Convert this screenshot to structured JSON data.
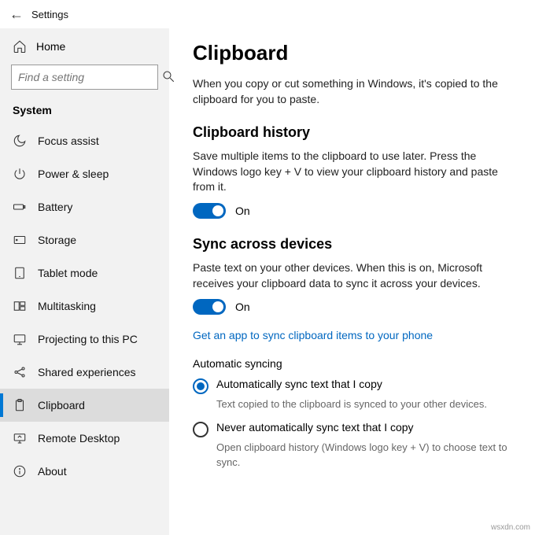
{
  "titlebar": {
    "title": "Settings"
  },
  "sidebar": {
    "home": "Home",
    "search_placeholder": "Find a setting",
    "category": "System",
    "items": [
      {
        "label": "Focus assist",
        "selected": false,
        "icon": "moon"
      },
      {
        "label": "Power & sleep",
        "selected": false,
        "icon": "power"
      },
      {
        "label": "Battery",
        "selected": false,
        "icon": "battery"
      },
      {
        "label": "Storage",
        "selected": false,
        "icon": "storage"
      },
      {
        "label": "Tablet mode",
        "selected": false,
        "icon": "tablet"
      },
      {
        "label": "Multitasking",
        "selected": false,
        "icon": "multitask"
      },
      {
        "label": "Projecting to this PC",
        "selected": false,
        "icon": "project"
      },
      {
        "label": "Shared experiences",
        "selected": false,
        "icon": "shared"
      },
      {
        "label": "Clipboard",
        "selected": true,
        "icon": "clipboard"
      },
      {
        "label": "Remote Desktop",
        "selected": false,
        "icon": "remote"
      },
      {
        "label": "About",
        "selected": false,
        "icon": "about"
      }
    ]
  },
  "main": {
    "title": "Clipboard",
    "intro": "When you copy or cut something in Windows, it's copied to the clipboard for you to paste.",
    "history": {
      "heading": "Clipboard history",
      "desc": "Save multiple items to the clipboard to use later. Press the Windows logo key + V to view your clipboard history and paste from it.",
      "toggle_state": "On"
    },
    "sync": {
      "heading": "Sync across devices",
      "desc": "Paste text on your other devices. When this is on, Microsoft receives your clipboard data to sync it across your devices.",
      "toggle_state": "On",
      "link": "Get an app to sync clipboard items to your phone",
      "auto_heading": "Automatic syncing",
      "radios": [
        {
          "label": "Automatically sync text that I copy",
          "desc": "Text copied to the clipboard is synced to your other devices.",
          "checked": true
        },
        {
          "label": "Never automatically sync text that I copy",
          "desc": "Open clipboard history (Windows logo key + V) to choose text to sync.",
          "checked": false
        }
      ]
    }
  },
  "watermark": "wsxdn.com"
}
